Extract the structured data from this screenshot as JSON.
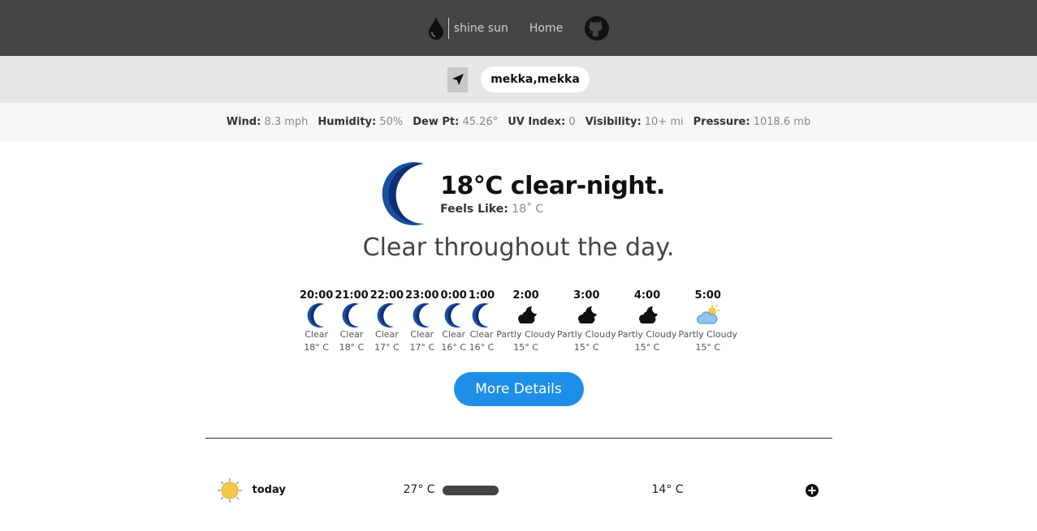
{
  "nav": {
    "brand": "shine sun",
    "home": "Home"
  },
  "search": {
    "city_value": "mekka,mekka"
  },
  "stats": [
    {
      "label": "Wind:",
      "value": "8.3 mph"
    },
    {
      "label": "Humidity:",
      "value": "50%"
    },
    {
      "label": "Dew Pt:",
      "value": "45.26°"
    },
    {
      "label": "UV Index:",
      "value": "0"
    },
    {
      "label": "Visibility:",
      "value": "10+ mi"
    },
    {
      "label": "Pressure:",
      "value": "1018.6 mb"
    }
  ],
  "current": {
    "title": "18°C clear-night.",
    "feels_label": "Feels Like:",
    "feels_value": "18˚ C",
    "summary": "Clear throughout the day."
  },
  "hourly": [
    {
      "time": "20:00",
      "icon": "moon-icon",
      "cond": "Clear",
      "temp": "18° C"
    },
    {
      "time": "21:00",
      "icon": "moon-icon",
      "cond": "Clear",
      "temp": "18° C"
    },
    {
      "time": "22:00",
      "icon": "moon-icon",
      "cond": "Clear",
      "temp": "17° C"
    },
    {
      "time": "23:00",
      "icon": "moon-icon",
      "cond": "Clear",
      "temp": "17° C"
    },
    {
      "time": "0:00",
      "icon": "moon-icon",
      "cond": "Clear",
      "temp": "16° C"
    },
    {
      "time": "1:00",
      "icon": "moon-icon",
      "cond": "Clear",
      "temp": "16° C"
    },
    {
      "time": "2:00",
      "icon": "cloudy-night-icon",
      "cond": "Partly Cloudy",
      "temp": "15° C"
    },
    {
      "time": "3:00",
      "icon": "cloudy-night-icon",
      "cond": "Partly Cloudy",
      "temp": "15° C"
    },
    {
      "time": "4:00",
      "icon": "cloudy-night-icon",
      "cond": "Partly Cloudy",
      "temp": "15° C"
    },
    {
      "time": "5:00",
      "icon": "cloudy-day-icon",
      "cond": "Partly Cloudy",
      "temp": "15° C"
    }
  ],
  "more_details": "More Details",
  "daily": [
    {
      "day": "today",
      "high": "27° C",
      "low": "14° C",
      "icon": "sun-icon"
    }
  ],
  "colors": {
    "topbar": "#454545",
    "accent": "#1e8fe8",
    "moon": "#0d3f8f"
  }
}
